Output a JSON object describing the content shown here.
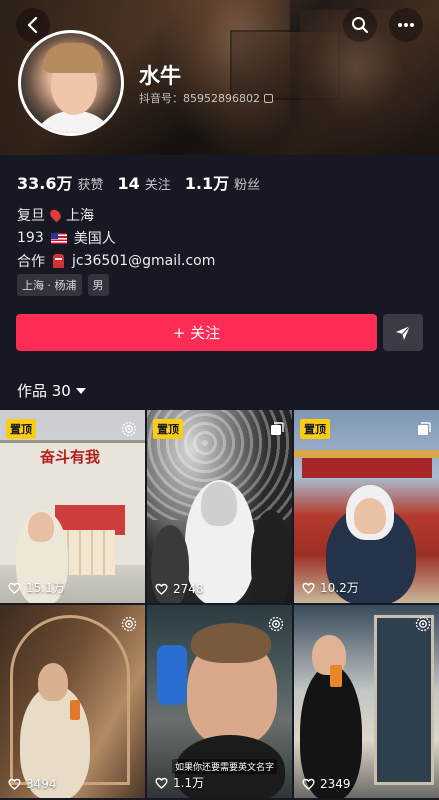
{
  "profile": {
    "nickname": "水牛",
    "account_label": "抖音号：85952896802",
    "stats": [
      {
        "num": "33.6万",
        "label": "获赞"
      },
      {
        "num": "14",
        "label": "关注"
      },
      {
        "num": "1.1万",
        "label": "粉丝"
      }
    ],
    "bio": {
      "line1_left": "复旦",
      "line1_right": "上海",
      "line2_left": "193",
      "line2_right": "美国人",
      "line3_left": "合作",
      "line3_right": "jc36501@gmail.com"
    },
    "tags": [
      "上海 · 杨浦",
      "男"
    ]
  },
  "actions": {
    "follow_label": "+ 关注"
  },
  "works": {
    "label": "作品 30"
  },
  "videos": [
    {
      "likes": "15.1万",
      "pinned": "置顶",
      "type": "live-photo-icon"
    },
    {
      "likes": "2748",
      "pinned": "置顶",
      "type": "multi-image-icon"
    },
    {
      "likes": "10.2万",
      "pinned": "置顶",
      "type": "multi-image-icon"
    },
    {
      "likes": "3494",
      "pinned": "",
      "type": "live-photo-icon"
    },
    {
      "likes": "1.1万",
      "pinned": "",
      "type": "live-photo-icon",
      "caption": "如果你还要需要英文名字"
    },
    {
      "likes": "2349",
      "pinned": "",
      "type": "live-photo-icon"
    }
  ],
  "colors": {
    "background": "#161823",
    "follow": "#fe2c55",
    "pinned": "#facc15"
  }
}
